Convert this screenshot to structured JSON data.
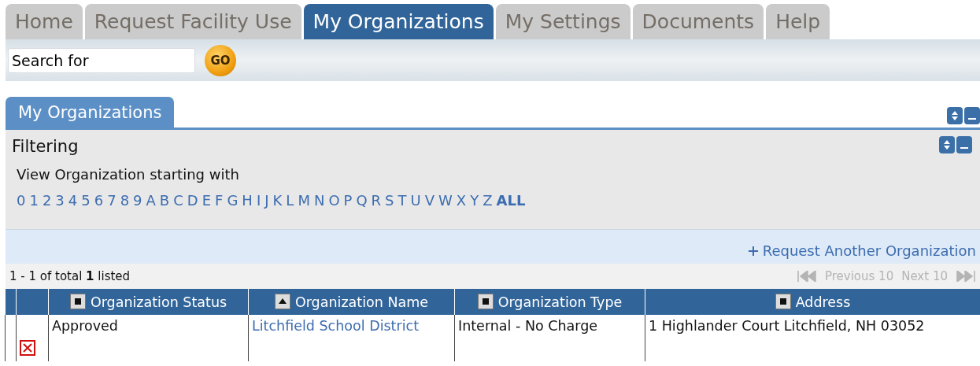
{
  "tabs": [
    {
      "label": "Home",
      "selected": false
    },
    {
      "label": "Request Facility Use",
      "selected": false
    },
    {
      "label": "My Organizations",
      "selected": true
    },
    {
      "label": "My Settings",
      "selected": false
    },
    {
      "label": "Documents",
      "selected": false
    },
    {
      "label": "Help",
      "selected": false
    }
  ],
  "search": {
    "value": "Search for",
    "button": "GO"
  },
  "panel": {
    "title": "My Organizations",
    "filtering": {
      "title": "Filtering",
      "prompt": "View Organization starting with",
      "letters": [
        {
          "label": "0",
          "selected": false
        },
        {
          "label": "1",
          "selected": false
        },
        {
          "label": "2",
          "selected": false
        },
        {
          "label": "3",
          "selected": false
        },
        {
          "label": "4",
          "selected": false
        },
        {
          "label": "5",
          "selected": false
        },
        {
          "label": "6",
          "selected": false
        },
        {
          "label": "7",
          "selected": false
        },
        {
          "label": "8",
          "selected": false
        },
        {
          "label": "9",
          "selected": false
        },
        {
          "label": "A",
          "selected": false
        },
        {
          "label": "B",
          "selected": false
        },
        {
          "label": "C",
          "selected": false
        },
        {
          "label": "D",
          "selected": false
        },
        {
          "label": "E",
          "selected": false
        },
        {
          "label": "F",
          "selected": false
        },
        {
          "label": "G",
          "selected": false
        },
        {
          "label": "H",
          "selected": false
        },
        {
          "label": "I",
          "selected": false
        },
        {
          "label": "J",
          "selected": false
        },
        {
          "label": "K",
          "selected": false
        },
        {
          "label": "L",
          "selected": false
        },
        {
          "label": "M",
          "selected": false
        },
        {
          "label": "N",
          "selected": false
        },
        {
          "label": "O",
          "selected": false
        },
        {
          "label": "P",
          "selected": false
        },
        {
          "label": "Q",
          "selected": false
        },
        {
          "label": "R",
          "selected": false
        },
        {
          "label": "S",
          "selected": false
        },
        {
          "label": "T",
          "selected": false
        },
        {
          "label": "U",
          "selected": false
        },
        {
          "label": "V",
          "selected": false
        },
        {
          "label": "W",
          "selected": false
        },
        {
          "label": "X",
          "selected": false
        },
        {
          "label": "Y",
          "selected": false
        },
        {
          "label": "Z",
          "selected": false
        },
        {
          "label": "ALL",
          "selected": true
        }
      ]
    },
    "request_link": "Request Another Organization",
    "count": "1 - 1 of total **1** listed",
    "pager": [
      {
        "label": "Previous 10",
        "disabled": true
      },
      {
        "label": "Next 10",
        "disabled": true
      }
    ],
    "table": {
      "columns": [
        {
          "label": "Organization Status",
          "kind": "unsorted"
        },
        {
          "label": "Organization Name",
          "kind": "ascending"
        },
        {
          "label": "Organization Type",
          "kind": "unsorted"
        },
        {
          "label": "Address",
          "kind": "unsorted"
        }
      ],
      "rows": [
        {
          "status": "Approved",
          "name": "Litchfield School District",
          "type": "Internal - No Charge",
          "address": "1 Highlander Court Litchfield, NH 03052"
        }
      ]
    }
  }
}
